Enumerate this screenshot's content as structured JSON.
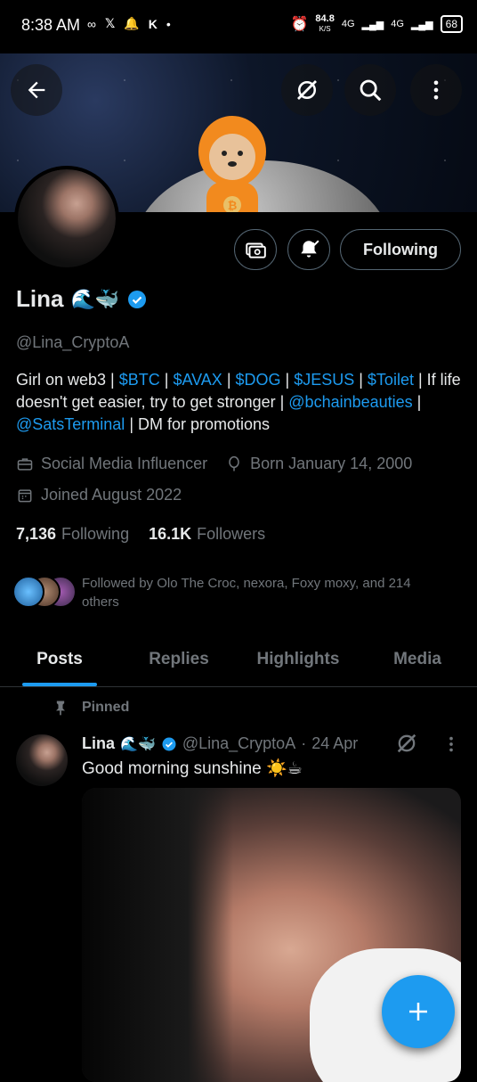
{
  "status_bar": {
    "time": "8:38 AM",
    "speed": "84.8",
    "speed_unit": "K/S",
    "network_1": "4G",
    "network_2": "4G",
    "battery": "68"
  },
  "profile": {
    "name": "Lina",
    "name_emojis": "🌊🐳",
    "handle": "@Lina_CryptoA",
    "bio": {
      "prefix": "Girl on web3 | ",
      "tag_btc": "$BTC",
      "sep1": " | ",
      "tag_avax": "$AVAX",
      "sep2": " | ",
      "tag_dog": "$DOG",
      "sep3": " | ",
      "tag_jesus": "$JESUS",
      "sep4": " | ",
      "tag_toilet": "$Toilet",
      "middle": " | If life doesn't get easier, try to get stronger | ",
      "mention1": "@bchainbeauties",
      "sep5": " | ",
      "mention2": "@SatsTerminal",
      "suffix": " | DM for promotions"
    },
    "category": "Social Media Influencer",
    "born": "Born January 14, 2000",
    "joined": "Joined August 2022",
    "following_count": "7,136",
    "following_label": "Following",
    "followers_count": "16.1K",
    "followers_label": "Followers",
    "followed_by": "Followed by Olo The Croc, nexora, Foxy moxy, and 214 others",
    "following_button": "Following"
  },
  "tabs": [
    "Posts",
    "Replies",
    "Highlights",
    "Media"
  ],
  "post": {
    "pinned_label": "Pinned",
    "name": "Lina",
    "name_emojis": "🌊🐳",
    "handle": "@Lina_CryptoA",
    "dot": "·",
    "date": "24 Apr",
    "text": "Good morning sunshine ☀️☕"
  },
  "colors": {
    "accent": "#1d9bf0",
    "background": "#000000",
    "muted_text": "#71767b"
  }
}
